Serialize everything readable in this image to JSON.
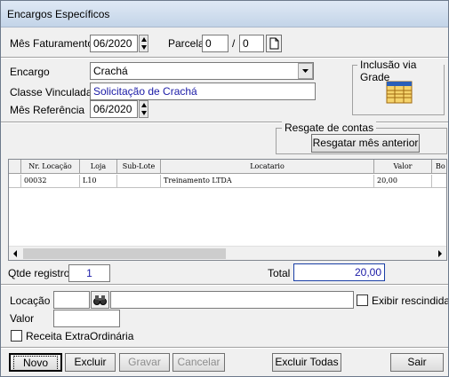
{
  "window": {
    "title": "Encargos Específicos"
  },
  "header": {
    "mes_faturamento_label": "Mês Faturamento",
    "mes_faturamento_value": "06/2020",
    "parcela_label": "Parcela",
    "parcela_value": "0",
    "parcela_sep": "/",
    "parcela_total": "0"
  },
  "form": {
    "encargo_label": "Encargo",
    "encargo_value": "Crachá",
    "classe_label": "Classe Vinculada",
    "classe_value": "Solicitação de Crachá",
    "mes_referencia_label": "Mês Referência",
    "mes_referencia_value": "06/2020"
  },
  "inclusao": {
    "title": "Inclusão via Grade"
  },
  "resgate": {
    "title": "Resgate de contas",
    "button": "Resgatar mês anterior"
  },
  "grid": {
    "columns": [
      "Nr. Locação",
      "Loja",
      "Sub-Lote",
      "Locatario",
      "Valor",
      "Bo"
    ],
    "rows": [
      [
        "00032",
        "L10",
        "",
        "Treinamento LTDA",
        "20,00",
        ""
      ]
    ]
  },
  "totals": {
    "qtde_label": "Qtde registros",
    "qtde_value": "1",
    "total_label": "Total",
    "total_value": "20,00"
  },
  "filter": {
    "locacao_label": "Locação",
    "locacao_value": "",
    "locacao_desc": "",
    "exibir_label": "Exibir rescindidas",
    "valor_label": "Valor",
    "valor_value": "",
    "receita_label": "Receita ExtraOrdinária"
  },
  "buttons": {
    "novo": "Novo",
    "excluir": "Excluir",
    "gravar": "Gravar",
    "cancelar": "Cancelar",
    "excluir_todas": "Excluir Todas",
    "sair": "Sair"
  },
  "colors": {
    "blue_text": "#1a1aa6",
    "grid_border": "#828790"
  }
}
